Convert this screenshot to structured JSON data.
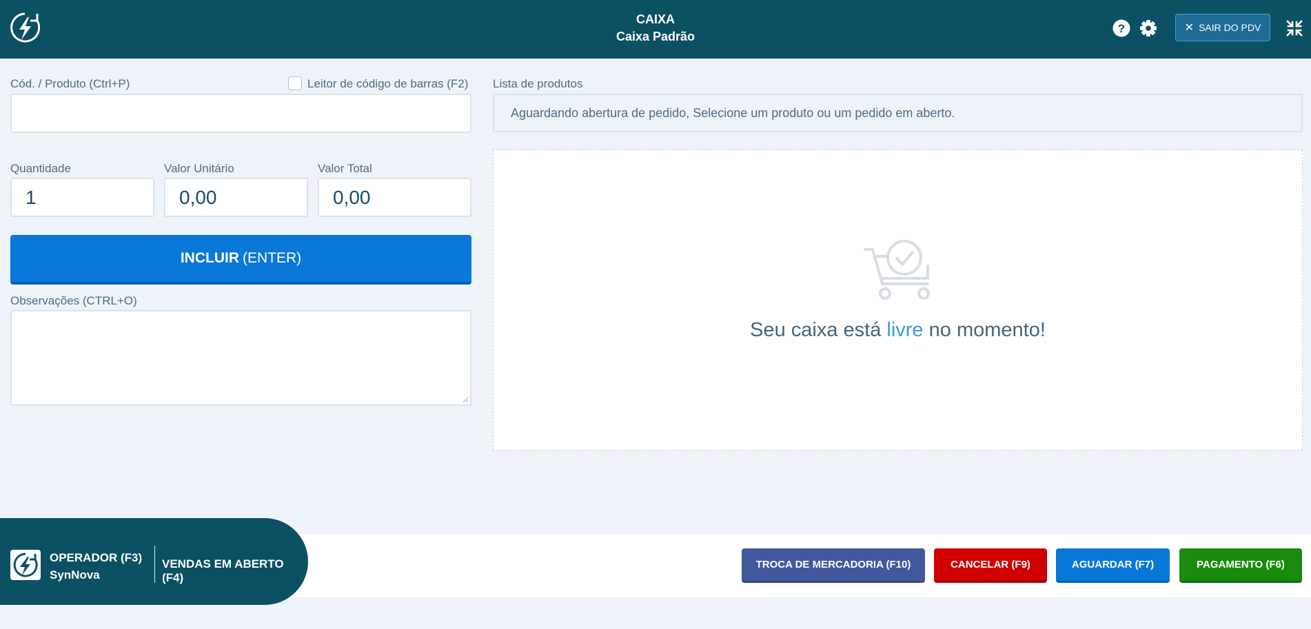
{
  "header": {
    "title": "CAIXA",
    "subtitle": "Caixa Padrão",
    "exit_label": "SAIR DO PDV",
    "icons": [
      "logo-icon",
      "help-icon",
      "gear-icon",
      "close-icon",
      "compress-icon"
    ]
  },
  "form": {
    "product_label": "Cód. / Produto (Ctrl+P)",
    "product_value": "",
    "barcode_label": "Leitor de código de barras (F2)",
    "barcode_checked": false,
    "quantity_label": "Quantidade",
    "quantity_value": "1",
    "unit_price_label": "Valor Unitário",
    "unit_price_value": "0,00",
    "total_label": "Valor Total",
    "total_value": "0,00",
    "include_bold": "INCLUIR",
    "include_key": "(ENTER)",
    "notes_label": "Observações (CTRL+O)",
    "notes_value": ""
  },
  "products": {
    "label": "Lista de produtos",
    "status": "Aguardando abertura de pedido, Selecione um produto ou um pedido em aberto.",
    "empty_prefix": "Seu caixa está",
    "empty_highlight": "livre",
    "empty_suffix": "no momento!"
  },
  "footer": {
    "operator_label": "OPERADOR (F3)",
    "operator_name": "SynNova",
    "open_sales_label": "VENDAS EM ABERTO (F4)",
    "buttons": {
      "exchange": "TROCA DE MERCADORIA (F10)",
      "cancel": "CANCELAR (F9)",
      "wait": "AGUARDAR (F7)",
      "payment": "PAGAMENTO (F6)"
    }
  },
  "colors": {
    "header_bg": "#0b5063",
    "primary": "#0a78d9",
    "danger": "#d10000",
    "success": "#1a8b0e",
    "exchange": "#42589d",
    "highlight": "#3b9ad8"
  }
}
